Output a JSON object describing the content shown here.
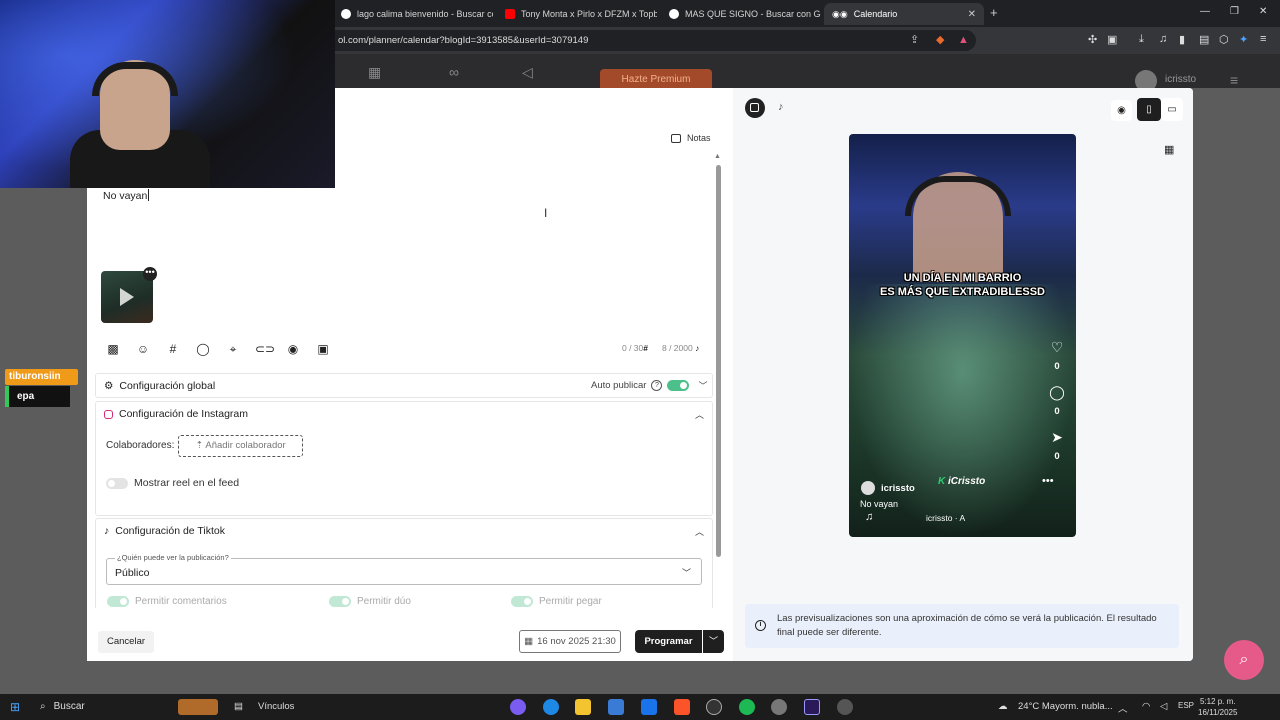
{
  "browser": {
    "tabs": [
      {
        "title": "lago calima bienvenido - Buscar con",
        "favicon_color": "#ffffff"
      },
      {
        "title": "Tony Monta x Pirlo x DFZM x Topboy",
        "favicon_color": "#ff0000"
      },
      {
        "title": "MAS QUE SIGNO - Buscar con Goog",
        "favicon_color": "#ffffff"
      },
      {
        "title": "Calendario",
        "favicon_color": "#ffffff"
      }
    ],
    "url": "ol.com/planner/calendar?blogId=3913585&userId=3079149"
  },
  "app": {
    "premium_label": "Hazte Premium",
    "username": "icrissto"
  },
  "composer": {
    "notes_label": "Notas",
    "text": "No vayan",
    "counter_hashtags": "0 / 30",
    "counter_chars": "8 / 2000",
    "global": {
      "title": "Configuración global",
      "auto_publish_label": "Auto publicar",
      "auto_publish": true
    },
    "instagram": {
      "title": "Configuración de Instagram",
      "collaborators_label": "Colaboradores:",
      "add_collaborator": "Añadir colaborador",
      "show_reel_label": "Mostrar reel en el feed",
      "show_reel": false
    },
    "tiktok": {
      "title": "Configuración de Tiktok",
      "who_can_see_label": "¿Quién puede ver la publicación?",
      "who_can_see_value": "Público",
      "permissions": [
        "Permitir comentarios",
        "Permitir dúo",
        "Permitir pegar"
      ]
    },
    "cancel_label": "Cancelar",
    "date_label": "16 nov 2025 21:30",
    "schedule_label": "Programar"
  },
  "preview": {
    "caption_line1": "UN DÍA EN MI BARRIO",
    "caption_line2": "ES MÁS QUE EXTRADIBLESSD",
    "likes": "0",
    "comments": "0",
    "shares": "0",
    "username": "icrissto",
    "watermark": "iCrissto",
    "post_caption": "No vayan",
    "audio": "icrissto · A",
    "info_text": "Las previsualizaciones son una aproximación de cómo se verá la publicación. El resultado final puede ser diferente."
  },
  "overlay": {
    "chat_user": "tiburonsiin",
    "chat_message": "epa"
  },
  "taskbar": {
    "search_label": "Buscar",
    "links_label": "Vínculos",
    "weather": "24°C  Mayorm. nubla...",
    "lang": "ESP",
    "time": "5:12 p. m.",
    "date": "16/11/2025"
  },
  "icons": [
    "instagram-icon",
    "tiktok-icon",
    "eye-icon",
    "mobile-icon",
    "desktop-icon",
    "grid-icon",
    "heart-icon",
    "comment-icon",
    "send-icon",
    "music-icon",
    "calendar-icon",
    "info-icon",
    "search-icon"
  ]
}
